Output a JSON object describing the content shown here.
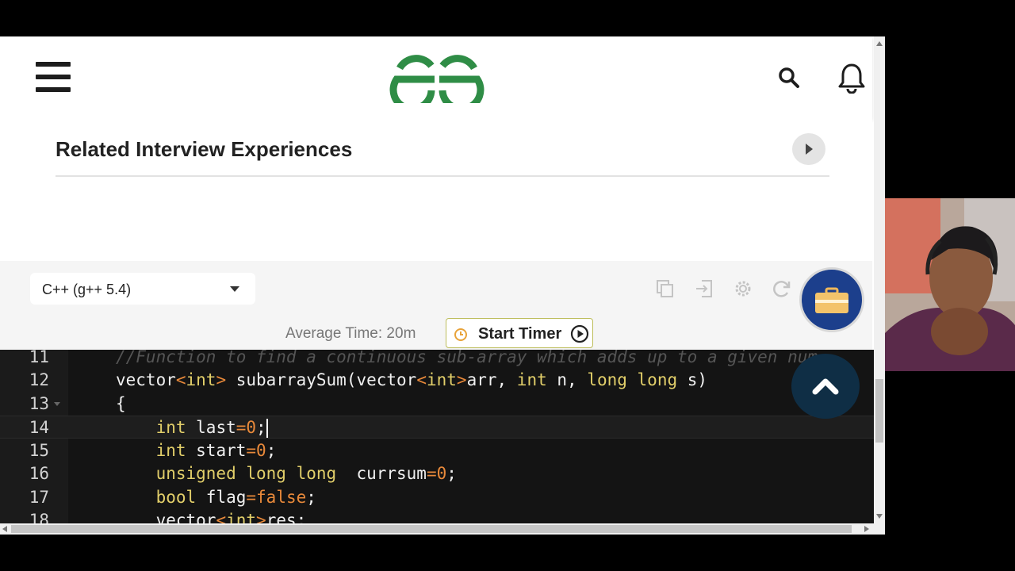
{
  "header": {
    "logo_alt": "GfG",
    "brand_color": "#2f8d46"
  },
  "related": {
    "title": "Related Interview Experiences"
  },
  "toolbar": {
    "language": "C++ (g++ 5.4)",
    "average_time": "Average Time: 20m",
    "start_timer": "Start Timer",
    "icons": [
      "copy-icon",
      "import-icon",
      "settings-icon",
      "reset-icon",
      "briefcase-icon"
    ]
  },
  "editor": {
    "active_line": 14,
    "lines": [
      {
        "num": "11",
        "text": "//Function to find a continuous sub-array which adds up to a given num"
      },
      {
        "num": "12",
        "text": "vector<int> subarraySum(vector<int>arr, int n, long long s)"
      },
      {
        "num": "13",
        "text": "{"
      },
      {
        "num": "14",
        "text": "    int last=0;"
      },
      {
        "num": "15",
        "text": "    int start=0;"
      },
      {
        "num": "16",
        "text": "    unsigned long long  currsum=0;"
      },
      {
        "num": "17",
        "text": "    bool flag=false;"
      },
      {
        "num": "18",
        "text": "    vector<int>res;"
      }
    ]
  }
}
